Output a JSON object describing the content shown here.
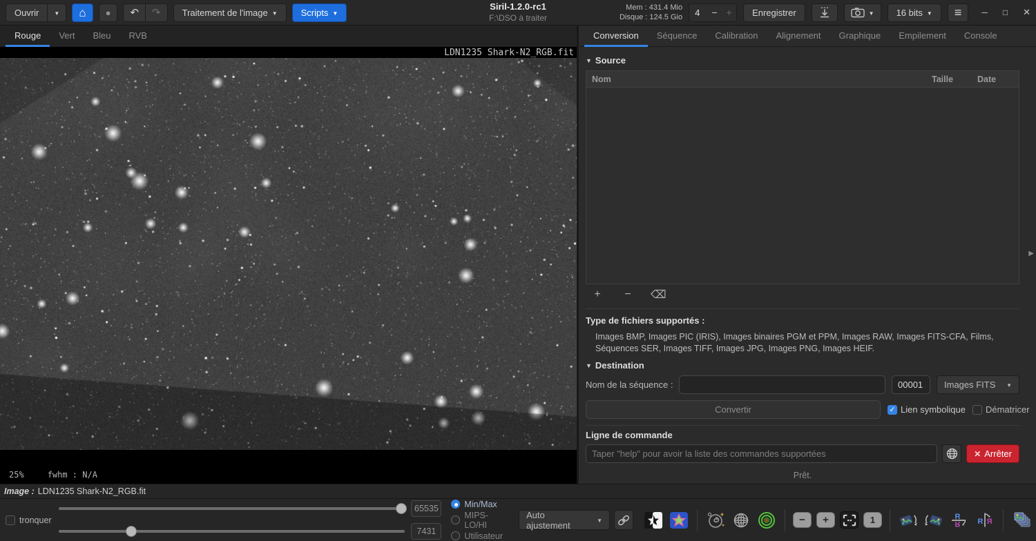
{
  "icons": {
    "dropdown": "▼",
    "home": "⌂",
    "record": "●",
    "undo": "↶",
    "redo": "↷",
    "minus": "−",
    "plus": "+",
    "clear_list": "⌫",
    "hamburger": "≡",
    "minimize": "─",
    "maximize": "□",
    "close": "✕",
    "stop_x": "✕",
    "check": "✓",
    "expander": "▼",
    "panel_arrow": "▶"
  },
  "header": {
    "open": "Ouvrir",
    "image_processing": "Traitement de l'image",
    "scripts": "Scripts",
    "title": "Siril-1.2.0-rc1",
    "working_dir": "F:\\DSO à traiter",
    "memory": "Mem : 431.4 Mio",
    "disk": "Disque : 124.5 Gio",
    "threads": "4",
    "save": "Enregistrer",
    "bit_depth": "16 bits"
  },
  "left_tabs": [
    "Rouge",
    "Vert",
    "Bleu",
    "RVB"
  ],
  "right_tabs": [
    "Conversion",
    "Séquence",
    "Calibration",
    "Alignement",
    "Graphique",
    "Empilement",
    "Console"
  ],
  "viewer": {
    "image_label": "LDN1235 Shark-N2_RGB.fit",
    "zoom": "25%",
    "fwhm": "fwhm : N/A"
  },
  "statusbar": {
    "prefix": "Image :",
    "filename": "LDN1235 Shark-N2_RGB.fit"
  },
  "conversion": {
    "source": "Source",
    "col_name": "Nom",
    "col_size": "Taille",
    "col_date": "Date",
    "supported_title": "Type de fichiers supportés :",
    "supported_list": "Images BMP, Images PIC (IRIS), Images binaires PGM et PPM, Images RAW, Images FITS-CFA, Films, Séquences SER, Images TIFF, Images JPG, Images PNG, Images HEIF.",
    "destination": "Destination",
    "sequence_label": "Nom de la séquence :",
    "start_index": "00001",
    "output_format": "Images FITS",
    "convert": "Convertir",
    "symlink": "Lien symbolique",
    "debayer": "Dématricer"
  },
  "command": {
    "title": "Ligne de commande",
    "placeholder": "Taper \"help\" pour avoir la liste des commandes supportées",
    "stop": "Arrêter",
    "status": "Prêt."
  },
  "footer": {
    "truncate": "tronquer",
    "high": "65535",
    "low": "7431",
    "radio_minmax": "Min/Max",
    "radio_mips": "MIPS-LO/HI",
    "radio_user": "Utilisateur",
    "autostretch": "Auto ajustement",
    "zoom_one": "1"
  }
}
